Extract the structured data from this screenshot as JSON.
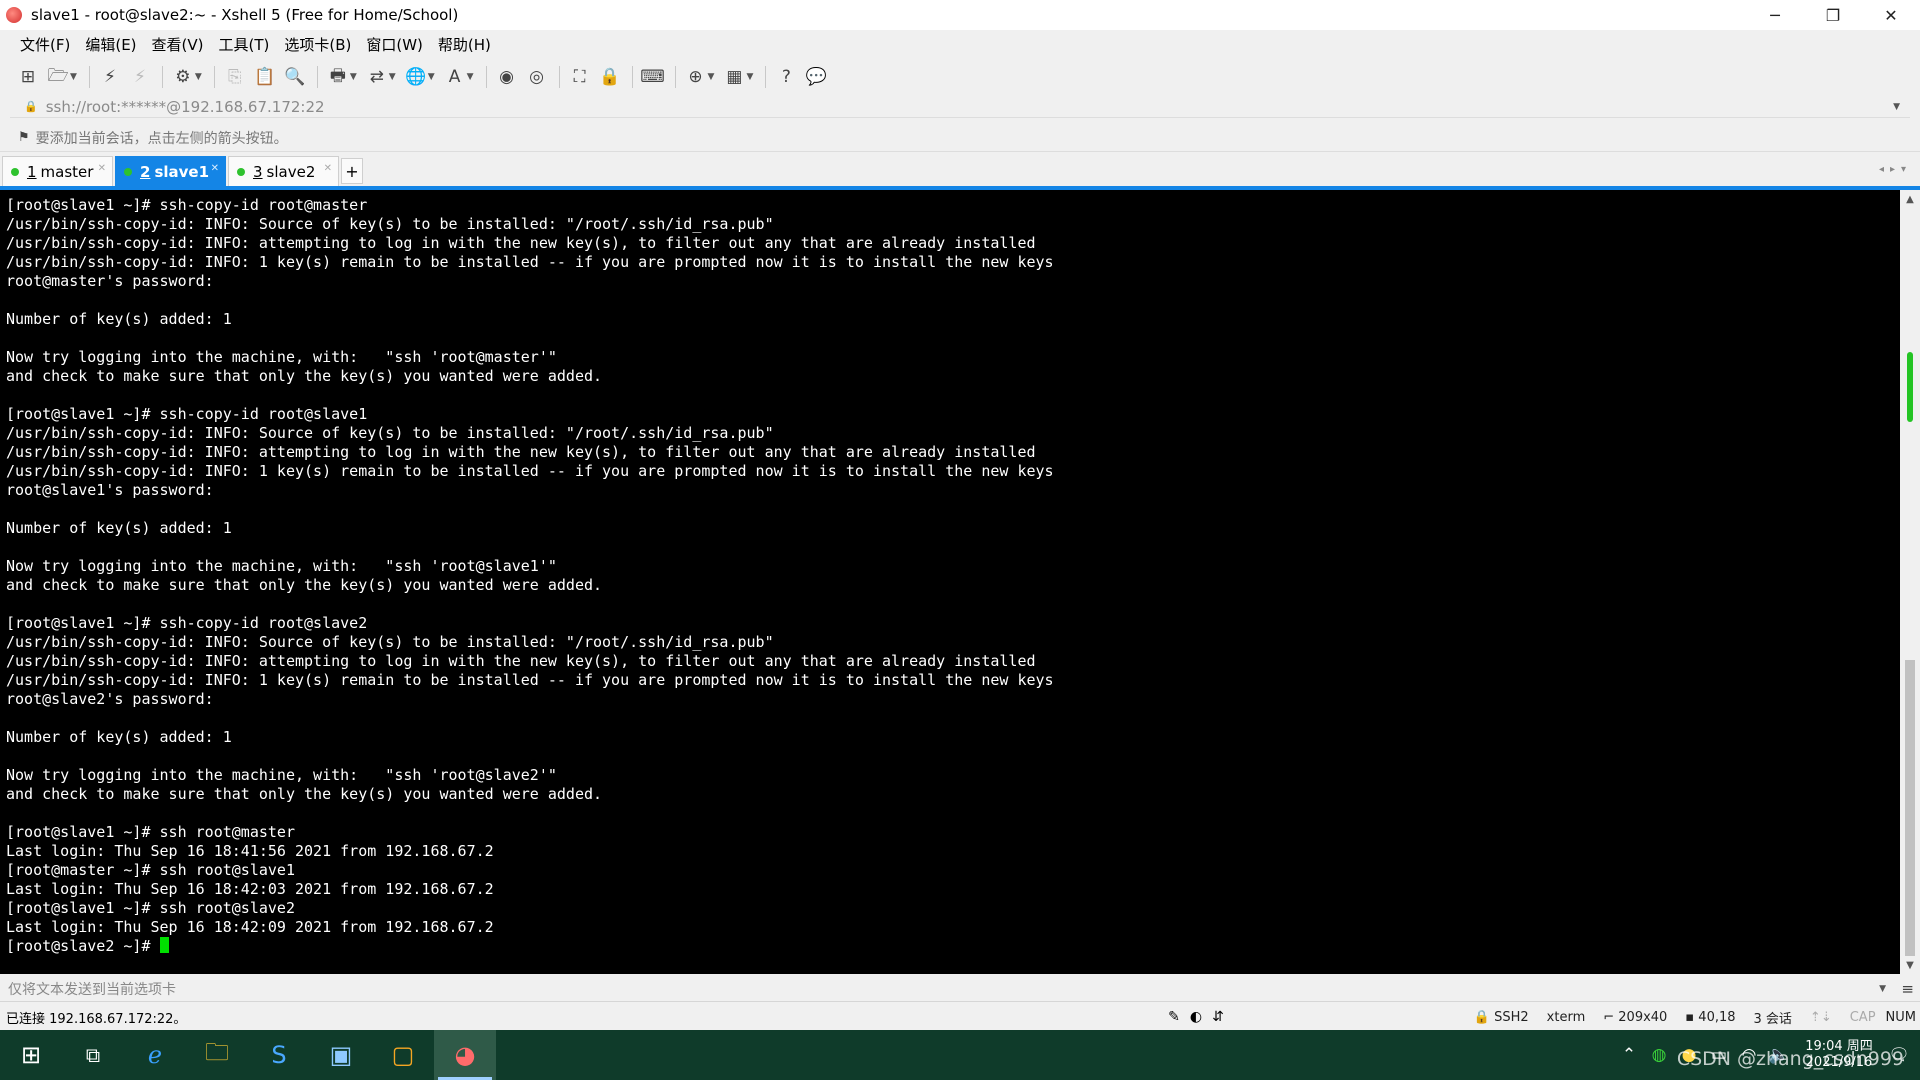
{
  "window": {
    "title": "slave1 - root@slave2:~ - Xshell 5 (Free for Home/School)"
  },
  "menu": [
    "文件(F)",
    "编辑(E)",
    "查看(V)",
    "工具(T)",
    "选项卡(B)",
    "窗口(W)",
    "帮助(H)"
  ],
  "address": {
    "value": "ssh://root:******@192.168.67.172:22"
  },
  "hint": {
    "text": "要添加当前会话，点击左侧的箭头按钮。"
  },
  "tabs": [
    {
      "num": "1",
      "label": "master",
      "active": false
    },
    {
      "num": "2",
      "label": "slave1",
      "active": true
    },
    {
      "num": "3",
      "label": "slave2",
      "active": false
    }
  ],
  "terminal": {
    "lines": [
      "[root@slave1 ~]# ssh-copy-id root@master",
      "/usr/bin/ssh-copy-id: INFO: Source of key(s) to be installed: \"/root/.ssh/id_rsa.pub\"",
      "/usr/bin/ssh-copy-id: INFO: attempting to log in with the new key(s), to filter out any that are already installed",
      "/usr/bin/ssh-copy-id: INFO: 1 key(s) remain to be installed -- if you are prompted now it is to install the new keys",
      "root@master's password:",
      "",
      "Number of key(s) added: 1",
      "",
      "Now try logging into the machine, with:   \"ssh 'root@master'\"",
      "and check to make sure that only the key(s) you wanted were added.",
      "",
      "[root@slave1 ~]# ssh-copy-id root@slave1",
      "/usr/bin/ssh-copy-id: INFO: Source of key(s) to be installed: \"/root/.ssh/id_rsa.pub\"",
      "/usr/bin/ssh-copy-id: INFO: attempting to log in with the new key(s), to filter out any that are already installed",
      "/usr/bin/ssh-copy-id: INFO: 1 key(s) remain to be installed -- if you are prompted now it is to install the new keys",
      "root@slave1's password:",
      "",
      "Number of key(s) added: 1",
      "",
      "Now try logging into the machine, with:   \"ssh 'root@slave1'\"",
      "and check to make sure that only the key(s) you wanted were added.",
      "",
      "[root@slave1 ~]# ssh-copy-id root@slave2",
      "/usr/bin/ssh-copy-id: INFO: Source of key(s) to be installed: \"/root/.ssh/id_rsa.pub\"",
      "/usr/bin/ssh-copy-id: INFO: attempting to log in with the new key(s), to filter out any that are already installed",
      "/usr/bin/ssh-copy-id: INFO: 1 key(s) remain to be installed -- if you are prompted now it is to install the new keys",
      "root@slave2's password:",
      "",
      "Number of key(s) added: 1",
      "",
      "Now try logging into the machine, with:   \"ssh 'root@slave2'\"",
      "and check to make sure that only the key(s) you wanted were added.",
      "",
      "[root@slave1 ~]# ssh root@master",
      "Last login: Thu Sep 16 18:41:56 2021 from 192.168.67.2",
      "[root@master ~]# ssh root@slave1",
      "Last login: Thu Sep 16 18:42:03 2021 from 192.168.67.2",
      "[root@slave1 ~]# ssh root@slave2",
      "Last login: Thu Sep 16 18:42:09 2021 from 192.168.67.2"
    ],
    "prompt": "[root@slave2 ~]# ",
    "cursor_color": "#00e000"
  },
  "send_bar": {
    "placeholder": "仅将文本发送到当前选项卡"
  },
  "status": {
    "connection": "已连接 192.168.67.172:22。",
    "protocol": "SSH2",
    "terminal_type": "xterm",
    "size": "209x40",
    "cursor_pos": "40,18",
    "sessions": "3 会话",
    "cap": "CAP",
    "num": "NUM"
  },
  "taskbar": {
    "time": "19:04 周四",
    "date": "2021/9/16",
    "watermark": "CSDN @zhang_csdn999"
  },
  "colors": {
    "accent": "#1485e6",
    "terminal_bg": "#000000",
    "taskbar_bg": "#0f3b2a"
  }
}
